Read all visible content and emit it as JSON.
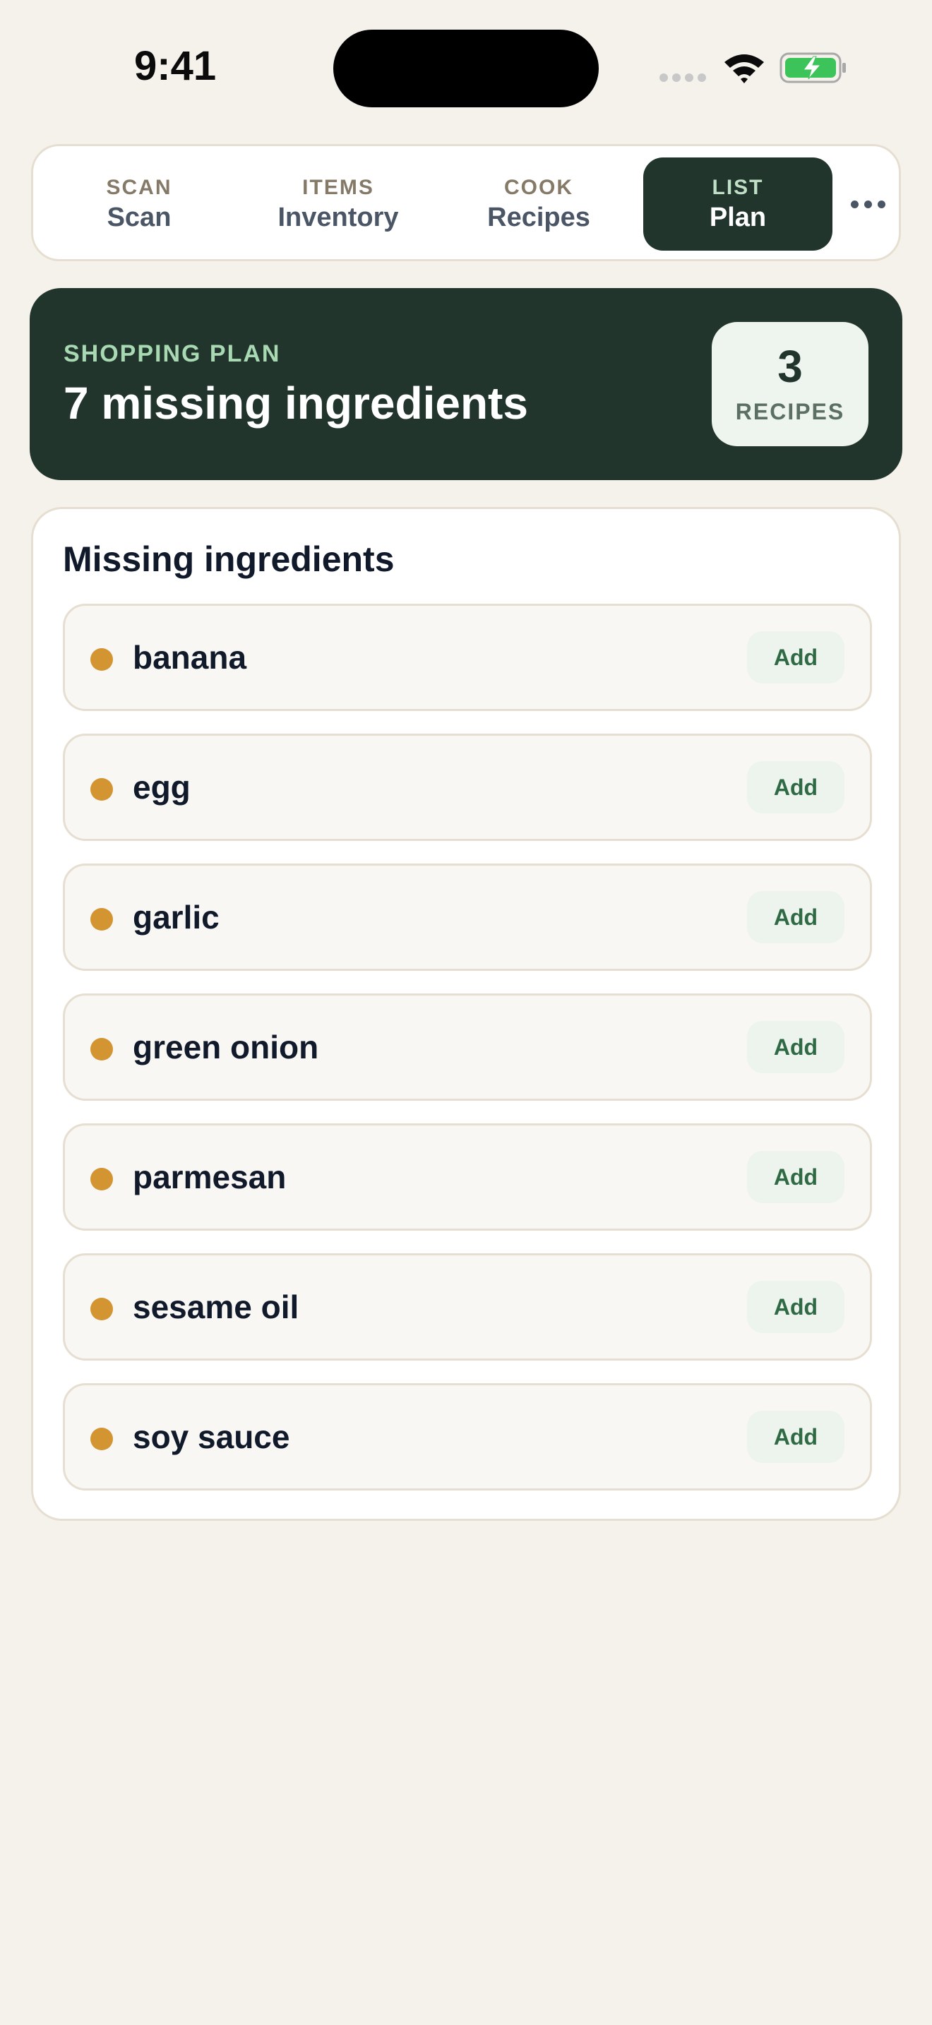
{
  "status_bar": {
    "time": "9:41"
  },
  "tabs": [
    {
      "caption": "SCAN",
      "label": "Scan",
      "active": false
    },
    {
      "caption": "ITEMS",
      "label": "Inventory",
      "active": false
    },
    {
      "caption": "COOK",
      "label": "Recipes",
      "active": false
    },
    {
      "caption": "LIST",
      "label": "Plan",
      "active": true
    }
  ],
  "hero": {
    "eyebrow": "SHOPPING PLAN",
    "title": "7 missing ingredients",
    "badge_count": "3",
    "badge_label": "RECIPES"
  },
  "missing": {
    "title": "Missing ingredients",
    "add_label": "Add",
    "items": [
      {
        "name": "banana"
      },
      {
        "name": "egg"
      },
      {
        "name": "garlic"
      },
      {
        "name": "green onion"
      },
      {
        "name": "parmesan"
      },
      {
        "name": "sesame oil"
      },
      {
        "name": "soy sauce"
      }
    ]
  },
  "colors": {
    "accent_dark": "#22352d",
    "accent_light": "#a9d9b3",
    "dot": "#d39532",
    "background": "#f5f2ec"
  }
}
